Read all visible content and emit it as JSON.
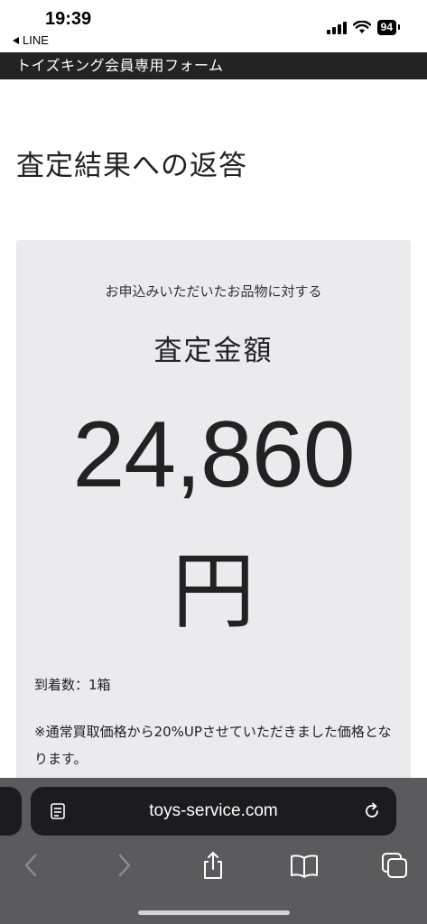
{
  "status": {
    "time": "19:39",
    "back_label": "LINE",
    "battery": "94"
  },
  "header": {
    "title": "トイズキング会員専用フォーム"
  },
  "page": {
    "title": "査定結果への返答"
  },
  "result": {
    "subtitle": "お申込みいただいたお品物に対する",
    "heading": "査定金額",
    "amount": "24,860",
    "unit": "円",
    "count": "到着数：1箱",
    "note": "※通常買取価格から20%UPさせていただきました価格となります。"
  },
  "browser": {
    "url": "toys-service.com"
  },
  "colors": {
    "header_bg": "#232323",
    "card_bg": "#ebebed",
    "toolbar_bg": "#5b5b5e",
    "urlbar_bg": "#1c1c1e"
  }
}
